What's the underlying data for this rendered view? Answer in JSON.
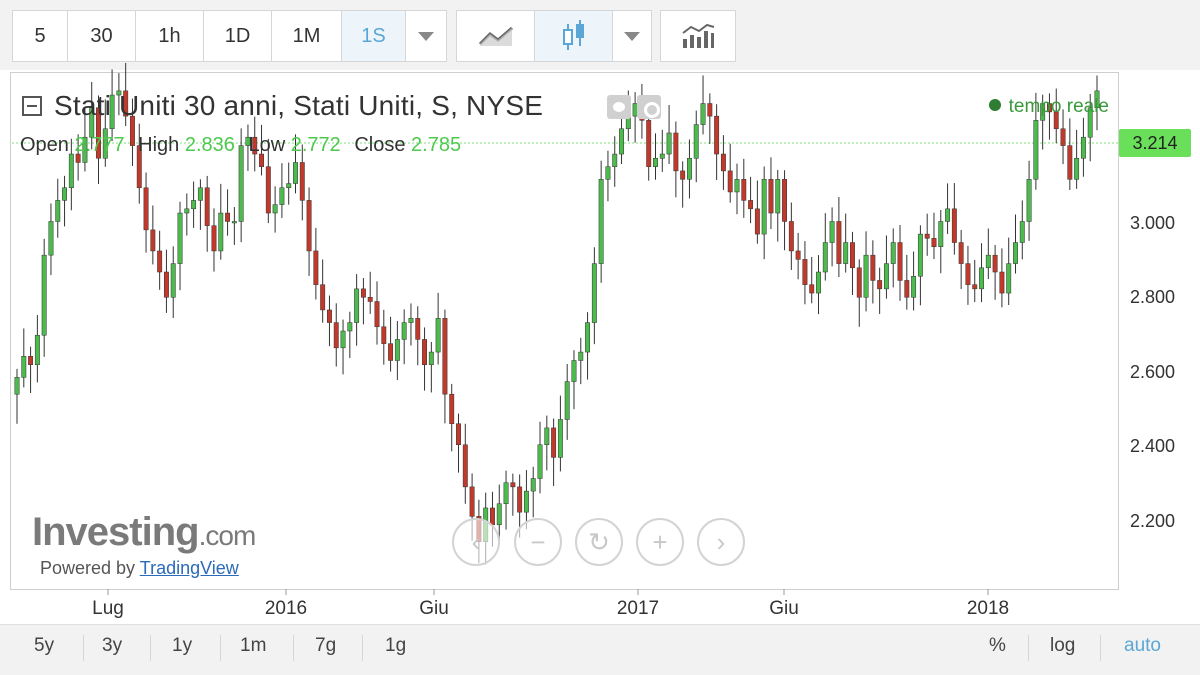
{
  "toolbar": {
    "intervals": [
      "5",
      "30",
      "1h",
      "1D",
      "1M",
      "1S"
    ],
    "active_interval": "1S"
  },
  "chart_header": {
    "title": "Stati Uniti 30 anni, Stati Uniti, S, NYSE",
    "realtime_label": "tempo reale",
    "ohlc": {
      "open_label": "Open",
      "open": "2.777",
      "high_label": "High",
      "high": "2.836",
      "low_label": "Low",
      "low": "2.772",
      "close_label": "Close",
      "close": "2.785"
    }
  },
  "current_price": "3.214",
  "branding": {
    "logo_main": "Investing",
    "logo_suffix": ".com",
    "powered_prefix": "Powered by",
    "powered_link": "TradingView"
  },
  "bottom": {
    "ranges": [
      "5y",
      "3y",
      "1y",
      "1m",
      "7g",
      "1g"
    ],
    "percent_label": "%",
    "log_label": "log",
    "auto_label": "auto"
  },
  "colors": {
    "up": "#4cba4c",
    "down": "#c0392b",
    "active_blue": "#5aa7d6",
    "price_tag": "#6adf5a"
  },
  "chart_data": {
    "type": "candlestick",
    "title": "Stati Uniti 30 anni, Stati Uniti, S, NYSE",
    "x_tick_labels": [
      "Lug",
      "2016",
      "Giu",
      "2017",
      "Giu",
      "2018"
    ],
    "y_tick_labels": [
      "2.200",
      "2.400",
      "2.600",
      "2.800",
      "3.000"
    ],
    "ylim": [
      2.03,
      3.25
    ],
    "grid": false,
    "series_close": [
      2.53,
      2.58,
      2.56,
      2.63,
      2.82,
      2.9,
      2.95,
      2.98,
      3.06,
      3.04,
      3.1,
      3.17,
      3.05,
      3.12,
      3.2,
      3.21,
      3.15,
      3.08,
      2.98,
      2.88,
      2.83,
      2.78,
      2.72,
      2.8,
      2.92,
      2.93,
      2.95,
      2.98,
      2.89,
      2.83,
      2.92,
      2.9,
      2.9,
      3.08,
      3.1,
      3.06,
      3.03,
      2.92,
      2.94,
      2.98,
      2.99,
      3.04,
      2.95,
      2.83,
      2.75,
      2.69,
      2.66,
      2.6,
      2.64,
      2.66,
      2.74,
      2.72,
      2.71,
      2.65,
      2.61,
      2.57,
      2.62,
      2.66,
      2.67,
      2.62,
      2.56,
      2.59,
      2.67,
      2.49,
      2.42,
      2.37,
      2.27,
      2.2,
      2.14,
      2.22,
      2.18,
      2.23,
      2.28,
      2.27,
      2.21,
      2.26,
      2.29,
      2.37,
      2.41,
      2.34,
      2.43,
      2.52,
      2.57,
      2.59,
      2.66,
      2.8,
      3.0,
      3.03,
      3.06,
      3.12,
      3.15,
      3.18,
      3.14,
      3.03,
      3.05,
      3.06,
      3.11,
      3.02,
      3.0,
      3.05,
      3.13,
      3.18,
      3.15,
      3.06,
      3.02,
      2.97,
      3.0,
      2.95,
      2.93,
      2.87,
      3.0,
      2.92,
      3.0,
      2.9,
      2.83,
      2.81,
      2.75,
      2.73,
      2.78,
      2.85,
      2.9,
      2.8,
      2.85,
      2.79,
      2.72,
      2.82,
      2.76,
      2.74,
      2.8,
      2.85,
      2.76,
      2.72,
      2.77,
      2.87,
      2.86,
      2.84,
      2.9,
      2.93,
      2.85,
      2.8,
      2.75,
      2.74,
      2.79,
      2.82,
      2.78,
      2.73,
      2.8,
      2.85,
      2.9,
      3.0,
      3.14,
      3.18,
      3.16,
      3.12,
      3.08,
      3.0,
      3.05,
      3.1,
      3.17,
      3.21
    ]
  }
}
